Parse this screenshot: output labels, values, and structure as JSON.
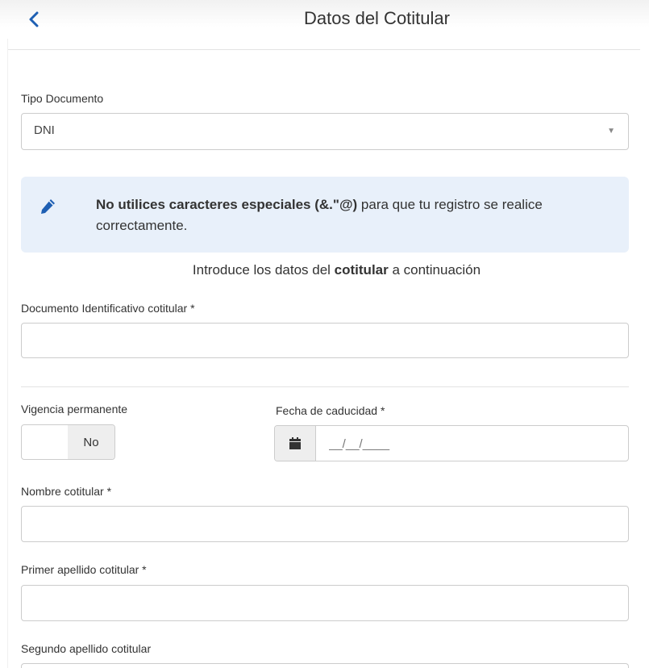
{
  "header": {
    "title": "Datos del Cotitular"
  },
  "tipo_documento": {
    "label": "Tipo Documento",
    "value": "DNI"
  },
  "info_box": {
    "bold_text": "No utilices caracteres especiales (&.\"@)",
    "text": " para que tu registro se realice correctamente."
  },
  "intro": {
    "prefix": "Introduce los datos del ",
    "bold": "cotitular",
    "suffix": " a continuación"
  },
  "documento": {
    "label": "Documento Identificativo cotitular *",
    "value": ""
  },
  "vigencia": {
    "label": "Vigencia permanente",
    "toggle_label": "No"
  },
  "fecha_caducidad": {
    "label": "Fecha de caducidad *",
    "placeholder": "__/__/____"
  },
  "nombre": {
    "label": "Nombre cotitular *",
    "value": ""
  },
  "primer_apellido": {
    "label": "Primer apellido cotitular *",
    "value": ""
  },
  "segundo_apellido": {
    "label": "Segundo apellido cotitular",
    "value": ""
  },
  "colors": {
    "accent": "#1e5fb3",
    "info_bg": "#e8f0fa"
  }
}
